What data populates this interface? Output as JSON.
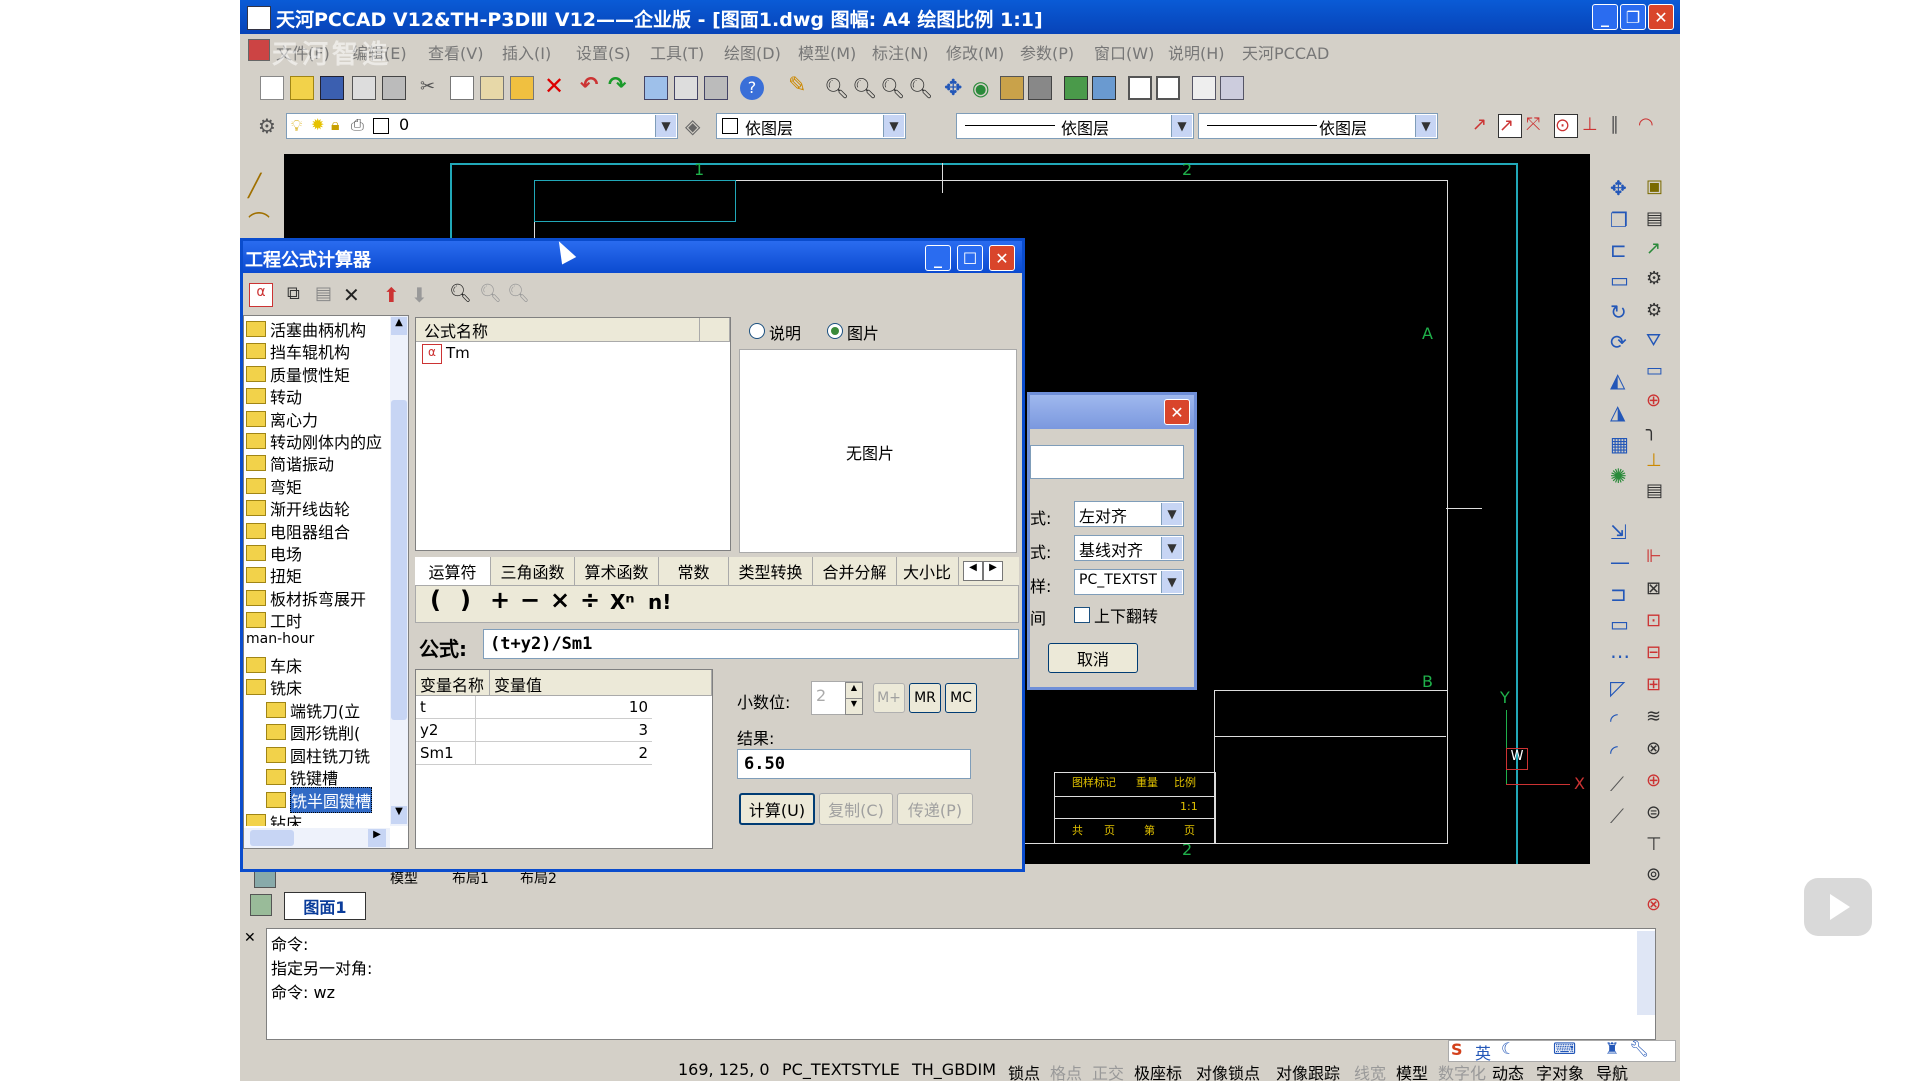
{
  "title": "天河PCCAD V12&TH-P3DⅢ V12——企业版 - [图面1.dwg 图幅: A4 绘图比例 1:1]",
  "menu": [
    "文件(F)",
    "编辑(E)",
    "查看(V)",
    "插入(I)",
    "设置(S)",
    "工具(T)",
    "绘图(D)",
    "模型(M)",
    "标注(N)",
    "修改(M)",
    "参数(P)",
    "窗口(W)",
    "说明(H)",
    "天河PCCAD"
  ],
  "watermark": "天河智造",
  "layer": {
    "current": "0",
    "color": "依图层",
    "linetype": "依图层",
    "lineweight": "依图层"
  },
  "drawing": {
    "zone_top_1": "1",
    "zone_top_2": "2",
    "zone_bottom_2": "2",
    "zone_a": "A",
    "zone_b": "B",
    "ucs_y": "Y",
    "ucs_x": "X",
    "ucs_w": "W",
    "tb_cell1": "图样标记",
    "tb_cell2": "重量",
    "tb_cell3": "比例",
    "tb_ratio": "1:1",
    "tb_cell4": "共",
    "tb_cell5": "页",
    "tb_cell6": "第",
    "tb_cell7": "页"
  },
  "layout_tabs": [
    "模型",
    "布局1",
    "布局2"
  ],
  "sheet_tab": "图面1",
  "calc": {
    "title": "工程公式计算器",
    "tree": [
      {
        "label": "活塞曲柄机构",
        "level": 0
      },
      {
        "label": "挡车辊机构",
        "level": 0
      },
      {
        "label": "质量惯性矩",
        "level": 0
      },
      {
        "label": "转动",
        "level": 0
      },
      {
        "label": "离心力",
        "level": 0
      },
      {
        "label": "转动刚体内的应",
        "level": 0
      },
      {
        "label": "简谐振动",
        "level": 0
      },
      {
        "label": "弯矩",
        "level": 0
      },
      {
        "label": "渐开线齿轮",
        "level": 0
      },
      {
        "label": "电阻器组合",
        "level": 0
      },
      {
        "label": "电场",
        "level": 0
      },
      {
        "label": "扭矩",
        "level": 0
      },
      {
        "label": "板材拆弯展开",
        "level": 0
      },
      {
        "label": "工时",
        "level": 0
      },
      {
        "label": "man-hour",
        "level": 0
      },
      {
        "label": "车床",
        "level": 0
      },
      {
        "label": "铣床",
        "level": 0
      },
      {
        "label": "端铣刀(立",
        "level": 1
      },
      {
        "label": "圆形铣削(",
        "level": 1
      },
      {
        "label": "圆柱铣刀铣",
        "level": 1
      },
      {
        "label": "铣键槽",
        "level": 1
      },
      {
        "label": "铣半圆键槽",
        "level": 1
      },
      {
        "label": "钻床",
        "level": 0
      }
    ],
    "list_header": "公式名称",
    "formula_item": "Tm",
    "radio_desc": "说明",
    "radio_pic": "图片",
    "no_picture": "无图片",
    "op_tabs": [
      "运算符",
      "三角函数",
      "算术函数",
      "常数",
      "类型转换",
      "合并分解",
      "大小比"
    ],
    "op_symbols": [
      "(",
      ")",
      "+",
      "−",
      "×",
      "÷",
      "Xⁿ",
      "n!"
    ],
    "formula_label": "公式:",
    "formula_value": "(t+y2)/Sm1",
    "var_headers": [
      "变量名称",
      "变量值"
    ],
    "vars": [
      {
        "name": "t",
        "value": "10"
      },
      {
        "name": "y2",
        "value": "3"
      },
      {
        "name": "Sm1",
        "value": "2"
      }
    ],
    "decimal_label": "小数位:",
    "decimal_value": "2",
    "mplus": "M+",
    "mr": "MR",
    "mc": "MC",
    "result_label": "结果:",
    "result_value": "6.50",
    "btn_calc": "计算(U)",
    "btn_copy": "复制(C)",
    "btn_send": "传递(P)"
  },
  "text_dialog": {
    "l1": "式:",
    "v1": "左对齐",
    "l2": "式:",
    "v2": "基线对齐",
    "l3": "样:",
    "v3": "PC_TEXTST",
    "l4": "间",
    "flip": "上下翻转",
    "cancel": "取消"
  },
  "command": {
    "line1": "命令:",
    "line2": "指定另一对角:",
    "line3": "命令: wz"
  },
  "ime": {
    "lang": "英"
  },
  "status": [
    "169, 125, 0",
    "PC_TEXTSTYLE",
    "TH_GBDIM",
    "锁点",
    "格点",
    "正交",
    "极座标",
    "对像锁点",
    "对像跟踪",
    "线宽",
    "模型",
    "数字化",
    "动态",
    "字对象",
    "导航"
  ]
}
